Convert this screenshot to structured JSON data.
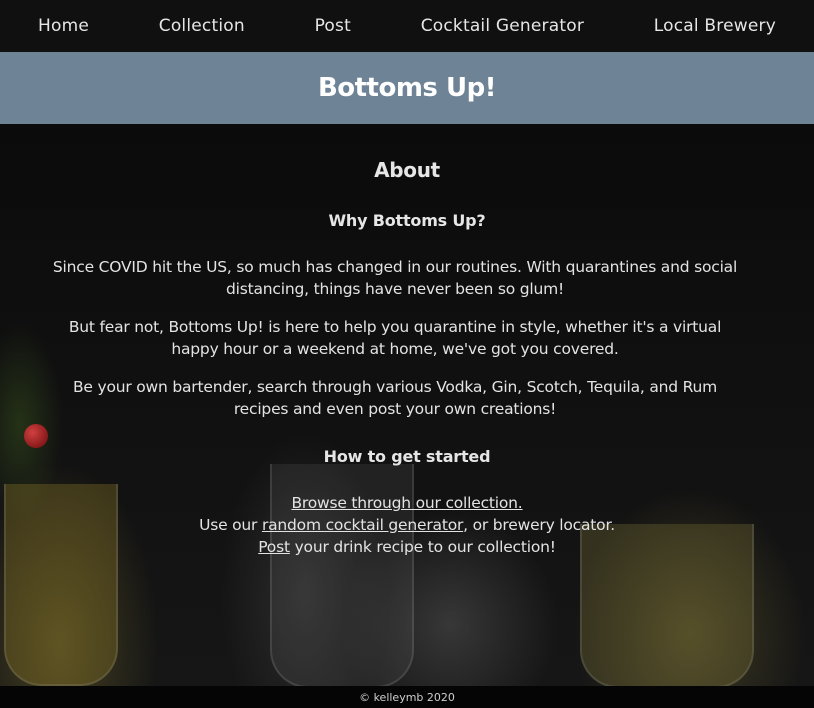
{
  "nav": {
    "items": [
      {
        "label": "Home"
      },
      {
        "label": "Collection"
      },
      {
        "label": "Post"
      },
      {
        "label": "Cocktail Generator"
      },
      {
        "label": "Local Brewery"
      }
    ]
  },
  "hero": {
    "title": "Bottoms Up!"
  },
  "about": {
    "heading": "About",
    "why_heading": "Why Bottoms Up?",
    "paragraphs": [
      "Since COVID hit the US, so much has changed in our routines. With quarantines and social distancing, things have never been so glum!",
      "But fear not, Bottoms Up! is here to help you quarantine in style, whether it's a virtual happy hour or a weekend at home, we've got you covered.",
      "Be your own bartender, search through various Vodka, Gin, Scotch, Tequila, and Rum recipes and even post your own creations!"
    ],
    "how_heading": "How to get started",
    "browse_link": "Browse through our collection.",
    "use_our_text": "Use our ",
    "generator_link": "random cocktail generator",
    "brewery_text": ", or brewery locator.",
    "post_link": "Post",
    "post_text": " your drink recipe to our collection!"
  },
  "footer": {
    "text": "© kelleymb 2020"
  },
  "colors": {
    "nav_bg": "#101010",
    "hero_bg": "#6f8397",
    "page_bg": "#0d0d0d"
  }
}
